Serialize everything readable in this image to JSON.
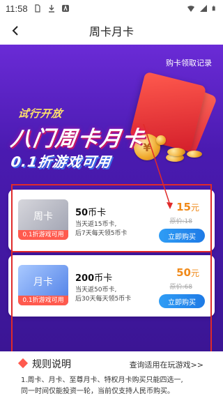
{
  "status_bar": {
    "time": "11:58",
    "left_icons": [
      "sim-icon",
      "download-icon",
      "app-icon"
    ],
    "right_icons": [
      "wifi-icon",
      "signal-icon",
      "battery-icon"
    ]
  },
  "nav": {
    "title": "周卡月卡",
    "back_icon": "chevron-left-icon"
  },
  "record_link": "购卡领取记录",
  "banner": {
    "line1": "试行开放",
    "line2": "八门周卡月卡",
    "line3": "0.1折游戏可用"
  },
  "cards": [
    {
      "thumb_label": "周卡",
      "thumb_badge": "0.1折游戏可用",
      "coins": "50",
      "coin_unit": "币卡",
      "desc_line1": "当天返15币卡,",
      "desc_line2": "后7天每天领5币卡",
      "price": "15",
      "price_unit": "元",
      "original_price": "原价:18",
      "button": "立即购买"
    },
    {
      "thumb_label": "月卡",
      "thumb_badge": "0.1折游戏可用",
      "coins": "200",
      "coin_unit": "币卡",
      "desc_line1": "当天返50币卡,",
      "desc_line2": "后30天每天领5币卡",
      "price": "50",
      "price_unit": "元",
      "original_price": "原价:68",
      "button": "立即购买"
    }
  ],
  "rules": {
    "title": "规则说明",
    "link": "查询适用在玩游戏>>",
    "text_line1": "1.周卡、月卡、至尊月卡、特权月卡购买只能四选一,",
    "text_line2": "同一时间仅能投资一轮，当前仅支持人民币购买。"
  },
  "colors": {
    "accent_purple": "#4a1ab0",
    "price_orange": "#f08a1a",
    "button_blue": "#1e7ae6",
    "badge_red": "#ff5a4e",
    "highlight_red": "#e02a2a"
  }
}
